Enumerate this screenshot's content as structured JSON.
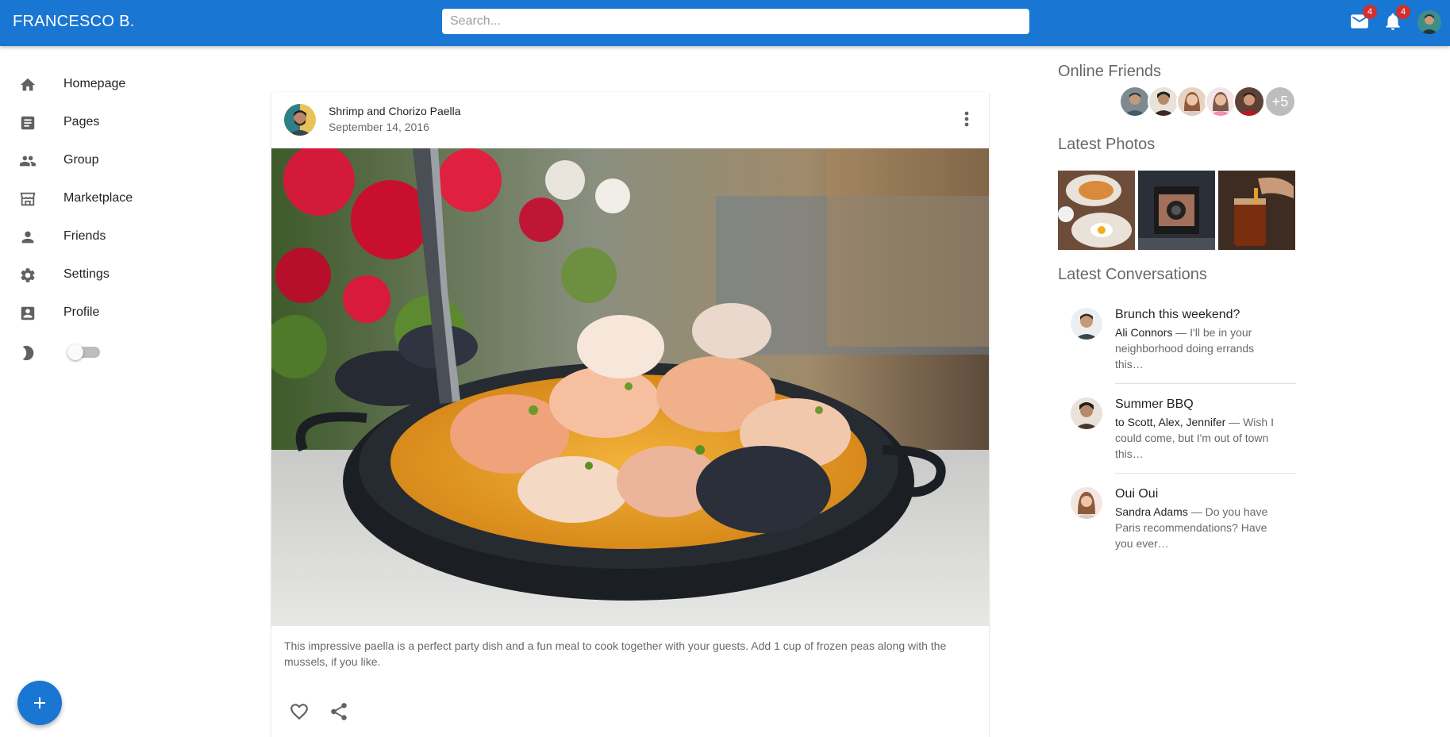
{
  "appbar": {
    "title": "FRANCESCO B.",
    "search_placeholder": "Search...",
    "mail_badge": "4",
    "notifications_badge": "4"
  },
  "sidebar": {
    "items": [
      {
        "label": "Homepage",
        "icon": "home-icon"
      },
      {
        "label": "Pages",
        "icon": "article-icon"
      },
      {
        "label": "Group",
        "icon": "group-icon"
      },
      {
        "label": "Marketplace",
        "icon": "storefront-icon"
      },
      {
        "label": "Friends",
        "icon": "person-icon"
      },
      {
        "label": "Settings",
        "icon": "gear-icon"
      },
      {
        "label": "Profile",
        "icon": "account-box-icon"
      }
    ],
    "dark_mode_enabled": false
  },
  "post": {
    "title": "Shrimp and Chorizo Paella",
    "date": "September 14, 2016",
    "body": "This impressive paella is a perfect party dish and a fun meal to cook together with your guests. Add 1 cup of frozen peas along with the mussels, if you like."
  },
  "right": {
    "online_title": "Online Friends",
    "online_more": "+5",
    "photos_title": "Latest Photos",
    "conversations_title": "Latest Conversations",
    "conversations": [
      {
        "title": "Brunch this weekend?",
        "from": "Ali Connors",
        "preview": " — I'll be in your neighborhood doing errands this…"
      },
      {
        "title": "Summer BBQ",
        "from": "to Scott, Alex, Jennifer",
        "preview": " — Wish I could come, but I'm out of town this…"
      },
      {
        "title": "Oui Oui",
        "from": "Sandra Adams",
        "preview": " — Do you have Paris recommendations? Have you ever…"
      }
    ]
  },
  "colors": {
    "primary": "#1976d2",
    "badge": "#d32f2f"
  }
}
